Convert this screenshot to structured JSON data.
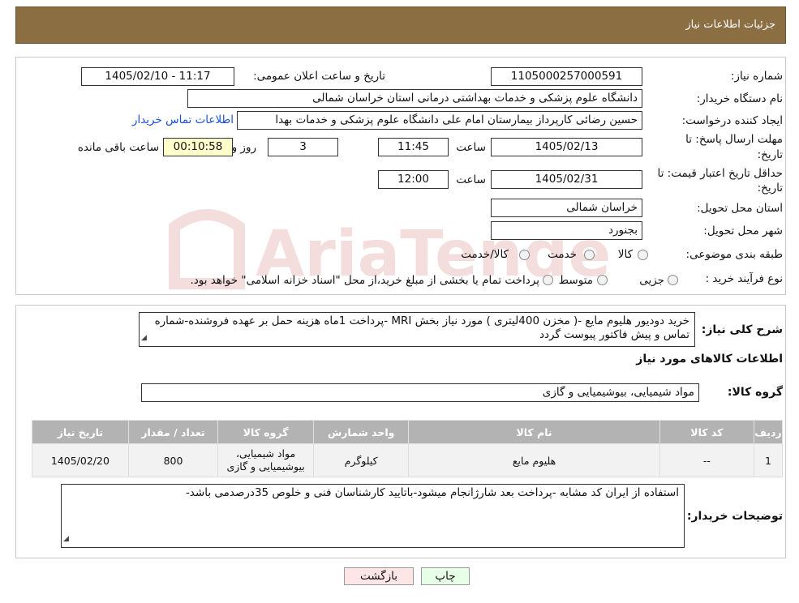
{
  "header": {
    "title": "جزئیات اطلاعات نیاز"
  },
  "watermark": {
    "text": "AriaTender.neT"
  },
  "form": {
    "need_number_label": "شماره نیاز:",
    "need_number": "1105000257000591",
    "announce_label": "تاریخ و ساعت اعلان عمومی:",
    "announce_value": "1405/02/10 - 11:17",
    "buyer_org_label": "نام دستگاه خریدار:",
    "buyer_org": "دانشگاه علوم پزشکی و خدمات بهداشتی درمانی استان خراسان شمالی",
    "creator_label": "ایجاد کننده درخواست:",
    "creator": "حسین رضائی کارپرداز بیمارستان امام علی دانشگاه علوم پزشکی و خدمات بهدا",
    "contact_link": "اطلاعات تماس خریدار",
    "reply_deadline_label_1": "مهلت ارسال پاسخ: تا",
    "reply_deadline_label_2": "تاریخ:",
    "reply_date": "1405/02/13",
    "time_label": "ساعت",
    "reply_time": "11:45",
    "days_value": "3",
    "days_label": "روز و",
    "remaining_time": "00:10:58",
    "remaining_label": "ساعت باقی مانده",
    "validity_label_1": "حداقل تاریخ اعتبار قیمت: تا",
    "validity_label_2": "تاریخ:",
    "validity_date": "1405/02/31",
    "validity_time_label": "ساعت",
    "validity_time": "12:00",
    "province_label": "استان محل تحویل:",
    "province": "خراسان شمالی",
    "city_label": "شهر محل تحویل:",
    "city": "بجنورد",
    "category_label": "طبقه بندی موضوعی:",
    "category_options": [
      "کالا",
      "خدمت",
      "کالا/خدمت"
    ],
    "purchase_type_label": "نوع فرآیند خرید :",
    "purchase_options": [
      "جزیی",
      "متوسط"
    ],
    "purchase_note": "پرداخت تمام یا بخشی از مبلغ خرید،از محل \"اسناد خزانه اسلامی\" خواهد بود."
  },
  "description": {
    "label": "شرح کلی نیاز:",
    "text": "خرید دودیور  هلیوم  مایع -( مخزن 400لیتری )  مورد نیاز بخش MRI -پرداخت 1ماه هزینه حمل بر عهده فروشنده-شماره تماس و پیش فاکتور پیوست گردد"
  },
  "items_section": {
    "title": "اطلاعات کالاهای مورد نیاز",
    "group_label": "گروه کالا:",
    "group_value": "مواد شیمیایی، بیوشیمیایی و  گازی"
  },
  "table": {
    "headers": [
      "ردیف",
      "کد کالا",
      "نام کالا",
      "واحد شمارش",
      "گروه کالا",
      "تعداد / مقدار",
      "تاریخ نیاز"
    ],
    "rows": [
      [
        "1",
        "--",
        "هلیوم مایع",
        "کیلوگرم",
        "مواد شیمیایی، بیوشیمیایی و گازی",
        "800",
        "1405/02/20"
      ]
    ]
  },
  "buyer_notes": {
    "label": "توضیحات خریدار:",
    "text": "استفاده از ایران کد مشابه -پرداخت بعد شارژانجام میشود-باتایید کارشناسان فنی و خلوص 35درصدمی باشد-"
  },
  "buttons": {
    "print": "چاپ",
    "back": "بازگشت"
  },
  "colors": {
    "header_bg": "#8b6f43",
    "link": "#1a4fd6",
    "print_bg": "#e6ffe6",
    "back_bg": "#ffe6e6"
  }
}
